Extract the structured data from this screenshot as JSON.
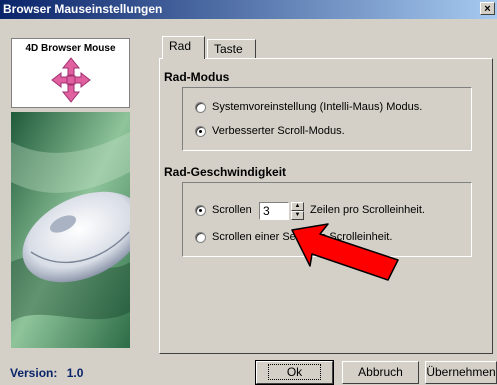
{
  "window": {
    "title": "Browser Mauseinstellungen",
    "close_label": "×"
  },
  "logo": {
    "title": "4D Browser Mouse",
    "icon": "four-way-arrow-icon"
  },
  "version": {
    "label": "Version:",
    "value": "1.0"
  },
  "tabs": [
    {
      "label": "Rad",
      "active": true
    },
    {
      "label": "Taste",
      "active": false
    }
  ],
  "rad_modus": {
    "heading": "Rad-Modus",
    "options": [
      {
        "label": "Systemvoreinstellung (Intelli-Maus) Modus.",
        "checked": false
      },
      {
        "label": "Verbesserter Scroll-Modus.",
        "checked": true
      }
    ]
  },
  "rad_geschwindigkeit": {
    "heading": "Rad-Geschwindigkeit",
    "scroll_label": "Scrollen",
    "scroll_value": "3",
    "scroll_suffix": "Zeilen pro Scrolleinheit.",
    "page_label": "Scrollen einer Seite pro Scrolleinheit.",
    "scroll_checked": true,
    "page_checked": false
  },
  "buttons": {
    "ok": "Ok",
    "cancel": "Abbruch",
    "apply": "Übernehmen"
  },
  "colors": {
    "titlebar": "#0a246a",
    "accent_arrow": "#ff0000",
    "logo_arrow": "#e060a0"
  }
}
